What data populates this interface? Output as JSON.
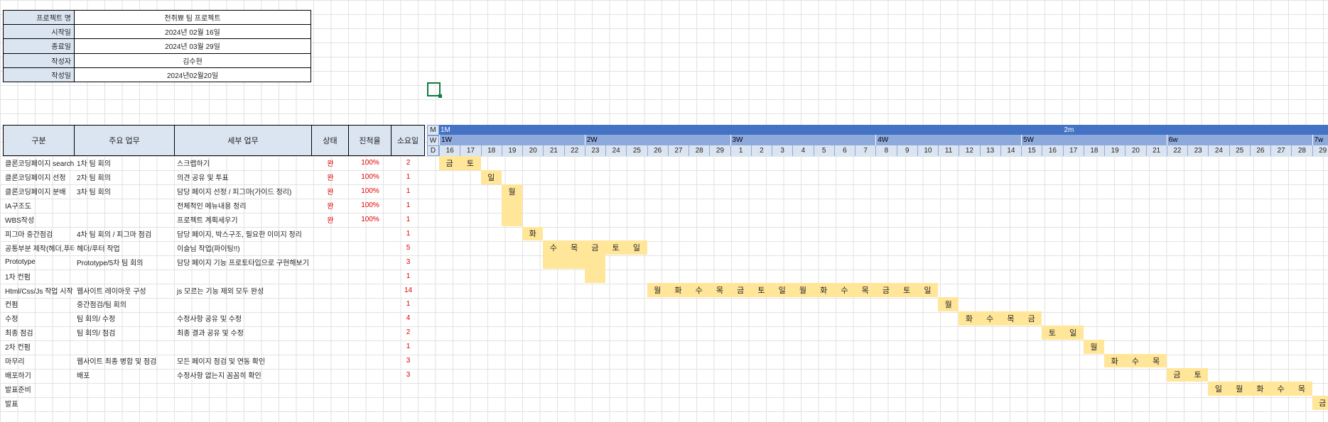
{
  "info": [
    {
      "label": "프로젝트 명",
      "value": "전쥐뾰 팀 프로젝트"
    },
    {
      "label": "시작일",
      "value": "2024년 02월 16일"
    },
    {
      "label": "종료일",
      "value": "2024년 03월 29일"
    },
    {
      "label": "작성자",
      "value": "김수현"
    },
    {
      "label": "작성일",
      "value": "2024년02월20일"
    }
  ],
  "columns": [
    "구분",
    "주요 업무",
    "세부 업무",
    "상태",
    "진척율",
    "소요일"
  ],
  "timeline": {
    "labels": [
      "M",
      "W",
      "D"
    ],
    "months": [
      {
        "label": "1M",
        "start": 0,
        "span": 30
      },
      {
        "label": "2m",
        "start": 30,
        "span": 13
      }
    ],
    "weeks": [
      {
        "label": "1W",
        "start": 0,
        "span": 7
      },
      {
        "label": "2W",
        "start": 7,
        "span": 7
      },
      {
        "label": "3W",
        "start": 14,
        "span": 7
      },
      {
        "label": "4W",
        "start": 21,
        "span": 7
      },
      {
        "label": "5W",
        "start": 28,
        "span": 7
      },
      {
        "label": "6w",
        "start": 35,
        "span": 7
      },
      {
        "label": "7w",
        "start": 42,
        "span": 1
      }
    ],
    "days": [
      "16",
      "17",
      "18",
      "19",
      "20",
      "21",
      "22",
      "23",
      "24",
      "25",
      "26",
      "27",
      "28",
      "29",
      "1",
      "2",
      "3",
      "4",
      "5",
      "6",
      "7",
      "8",
      "9",
      "10",
      "11",
      "12",
      "13",
      "14",
      "15",
      "16",
      "17",
      "18",
      "19",
      "20",
      "21",
      "22",
      "23",
      "24",
      "25",
      "26",
      "27",
      "28",
      "29"
    ]
  },
  "tasks": [
    {
      "category": "클론코딩페이지 search",
      "main": "1차 팀 회의",
      "detail": "스크랩하기",
      "status": "완",
      "progress": "100%",
      "days": "2",
      "bar": {
        "start": 0,
        "len": 2
      },
      "labels": [
        "금",
        "토"
      ]
    },
    {
      "category": "클론코딩페이지 선정",
      "main": "2차 팀 회의",
      "detail": "의견 공유 및 투표",
      "status": "완",
      "progress": "100%",
      "days": "1",
      "bar": {
        "start": 2,
        "len": 1
      },
      "labels": [
        "일"
      ]
    },
    {
      "category": "클론코딩페이지 분배",
      "main": "3차 팀 회의",
      "detail": "담당 페이지 선정 / 피그마(가이드 정리)",
      "status": "완",
      "progress": "100%",
      "days": "1",
      "bar": {
        "start": 3,
        "len": 1
      },
      "labels": [
        "월"
      ]
    },
    {
      "category": "IA구조도",
      "main": "",
      "detail": "전체적인 메뉴내용 정리",
      "status": "완",
      "progress": "100%",
      "days": "1",
      "bar": {
        "start": 3,
        "len": 1
      },
      "labels": [
        ""
      ]
    },
    {
      "category": "WBS작성",
      "main": "",
      "detail": "프로젝트 계획세우기",
      "status": "완",
      "progress": "100%",
      "days": "1",
      "bar": {
        "start": 3,
        "len": 1
      },
      "labels": [
        ""
      ]
    },
    {
      "category": "피그마 중간점검",
      "main": "4차 팀 회의 / 피그마 점검",
      "detail": "담당 페이지, 박스구조, 필요한 이미지 정리",
      "status": "",
      "progress": "",
      "days": "1",
      "bar": {
        "start": 4,
        "len": 1
      },
      "labels": [
        "화"
      ]
    },
    {
      "category": "공통부분 제작(헤더,푸터)",
      "main": "헤더/푸터 작업",
      "detail": "이슬님 작업(파이팅!!)",
      "status": "",
      "progress": "",
      "days": "5",
      "bar": {
        "start": 5,
        "len": 5
      },
      "labels": [
        "수",
        "목",
        "금",
        "토",
        "일"
      ]
    },
    {
      "category": "Prototype",
      "main": "Prototype/5차 팀 회의",
      "detail": "담당 페이지 기능 프로토타입으로 구현해보기",
      "status": "",
      "progress": "",
      "days": "3",
      "bar": {
        "start": 5,
        "len": 3
      },
      "labels": [
        "",
        "",
        ""
      ]
    },
    {
      "category": "1차 컨펌",
      "main": "",
      "detail": "",
      "status": "",
      "progress": "",
      "days": "1",
      "bar": {
        "start": 7,
        "len": 1
      },
      "labels": [
        ""
      ]
    },
    {
      "category": "Html/Css/Js 작업 시작",
      "main": "웹사이트 레이아웃 구성",
      "detail": "js 모르는 기능 제외 모두 완성",
      "status": "",
      "progress": "",
      "days": "14",
      "bar": {
        "start": 10,
        "len": 14
      },
      "labels": [
        "월",
        "화",
        "수",
        "목",
        "금",
        "토",
        "일",
        "월",
        "화",
        "수",
        "목",
        "금",
        "토",
        "일"
      ]
    },
    {
      "category": "컨펌",
      "main": "중간점검/팀 회의",
      "detail": "",
      "status": "",
      "progress": "",
      "days": "1",
      "bar": {
        "start": 24,
        "len": 1
      },
      "labels": [
        "월"
      ]
    },
    {
      "category": "수정",
      "main": "팀 회의/ 수정",
      "detail": "수정사항 공유 및 수정",
      "status": "",
      "progress": "",
      "days": "4",
      "bar": {
        "start": 25,
        "len": 4
      },
      "labels": [
        "화",
        "수",
        "목",
        "금"
      ]
    },
    {
      "category": "최종 점검",
      "main": "팀 회의/ 점검",
      "detail": "최종 결과 공유 및 수정",
      "status": "",
      "progress": "",
      "days": "2",
      "bar": {
        "start": 29,
        "len": 2
      },
      "labels": [
        "토",
        "일"
      ]
    },
    {
      "category": "2차 컨펌",
      "main": "",
      "detail": "",
      "status": "",
      "progress": "",
      "days": "1",
      "bar": {
        "start": 31,
        "len": 1
      },
      "labels": [
        "월"
      ]
    },
    {
      "category": "마무리",
      "main": "웹사이트 최종 병합 및 점검",
      "detail": "모든 페이지 점검 및 연동 확인",
      "status": "",
      "progress": "",
      "days": "3",
      "bar": {
        "start": 32,
        "len": 3
      },
      "labels": [
        "화",
        "수",
        "목"
      ]
    },
    {
      "category": "배포하기",
      "main": "배포",
      "detail": "수정사항 없는지 꼼꼼히 확인",
      "status": "",
      "progress": "",
      "days": "3",
      "bar": {
        "start": 35,
        "len": 2
      },
      "labels": [
        "금",
        "토"
      ]
    },
    {
      "category": "발표준비",
      "main": "",
      "detail": "",
      "status": "",
      "progress": "",
      "days": "",
      "bar": {
        "start": 37,
        "len": 5
      },
      "labels": [
        "일",
        "월",
        "화",
        "수",
        "목"
      ]
    },
    {
      "category": "발표",
      "main": "",
      "detail": "",
      "status": "",
      "progress": "",
      "days": "",
      "bar": {
        "start": 42,
        "len": 1
      },
      "labels": [
        "금"
      ]
    }
  ]
}
